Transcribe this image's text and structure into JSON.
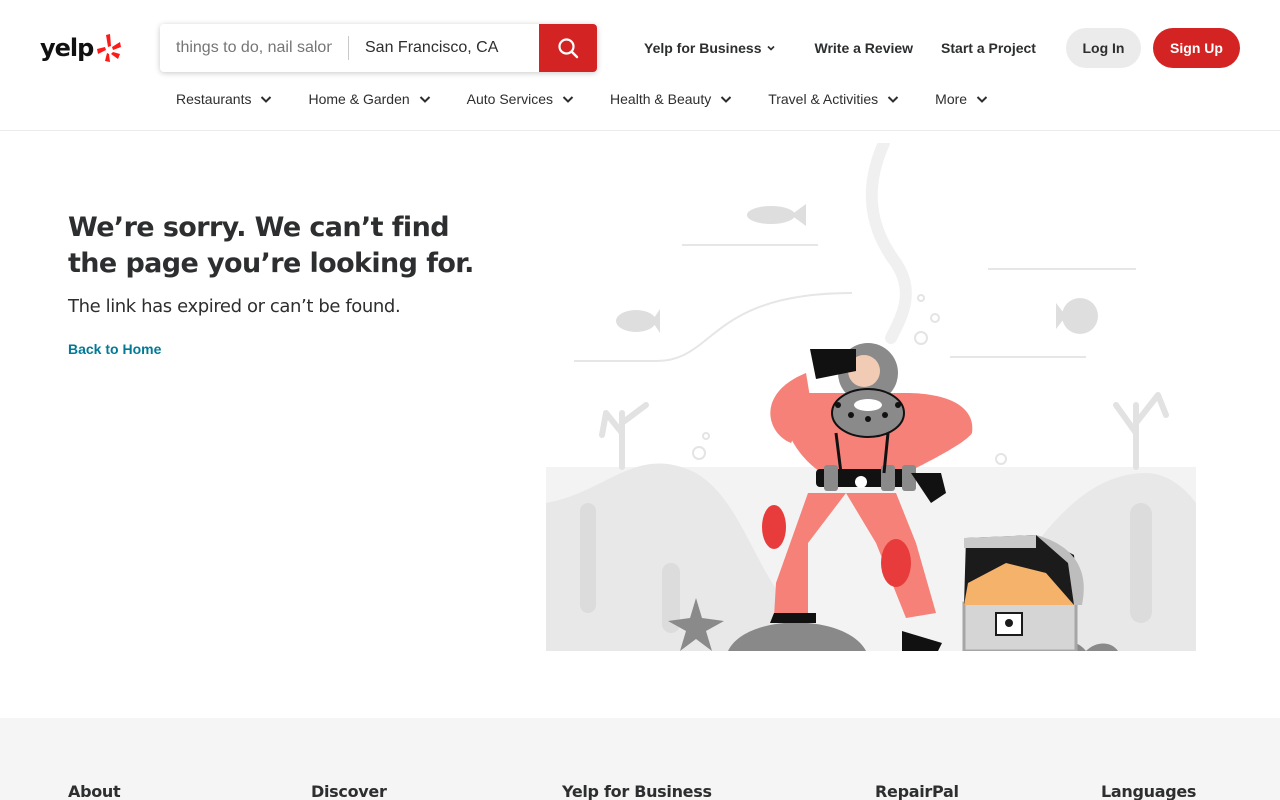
{
  "brand": {
    "logo_text": "yelp",
    "accent": "#d32323"
  },
  "search": {
    "find_placeholder": "things to do, nail salons, plumbers",
    "near_value": "San Francisco, CA"
  },
  "top_nav": {
    "business": "Yelp for Business",
    "write_review": "Write a Review",
    "start_project": "Start a Project",
    "login": "Log In",
    "signup": "Sign Up"
  },
  "categories": [
    {
      "label": "Restaurants"
    },
    {
      "label": "Home & Garden"
    },
    {
      "label": "Auto Services"
    },
    {
      "label": "Health & Beauty"
    },
    {
      "label": "Travel & Activities"
    },
    {
      "label": "More"
    }
  ],
  "error": {
    "title": "We’re sorry. We can’t find the page you’re looking for.",
    "subtitle": "The link has expired or can’t be found.",
    "back_link": "Back to Home"
  },
  "footer": {
    "headings": [
      "About",
      "Discover",
      "Yelp for Business",
      "RepairPal",
      "Languages"
    ]
  }
}
